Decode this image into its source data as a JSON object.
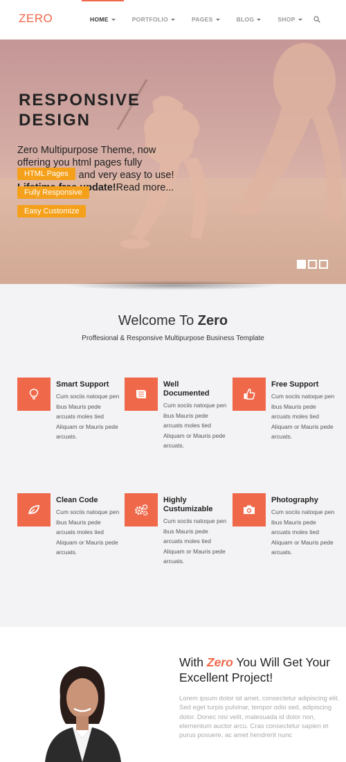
{
  "header": {
    "logo": "ZERO",
    "nav": [
      {
        "label": "HOME",
        "active": true
      },
      {
        "label": "PORTFOLIO",
        "active": false
      },
      {
        "label": "PAGES",
        "active": false
      },
      {
        "label": "BLOG",
        "active": false
      },
      {
        "label": "SHOP",
        "active": false
      }
    ],
    "search_icon": "search-icon"
  },
  "hero": {
    "title_line1": "RESPONSIVE",
    "title_line2": "DESIGN",
    "text": "Zero Multipurpose Theme, now offering you html pages fully customizable and very easy to use!",
    "lifetime": "Lifetime free update!",
    "read_more": "Read more...",
    "buttons": [
      "HTML Pages",
      "Fully Responsive",
      "Easy Customize"
    ],
    "slides_total": 3,
    "slide_active": 1
  },
  "welcome": {
    "title_prefix": "Welcome To ",
    "title_brand": "Zero",
    "subtitle": "Proffesional & Responsive Multipurpose Business Template"
  },
  "features": [
    {
      "title": "Smart Support",
      "icon": "lightbulb-icon",
      "text": "Cum sociis natoque pen ibus Mauris pede arcuats moles tied Aliquam or Mauris pede arcuats."
    },
    {
      "title": "Well Documented",
      "icon": "book-icon",
      "text": "Cum sociis natoque pen ibus Mauris pede arcuats moles tied Aliquam or Mauris pede arcuats."
    },
    {
      "title": "Free Support",
      "icon": "thumbs-up-icon",
      "text": "Cum sociis natoque pen ibus Mauris pede arcuats moles tied Aliquam or Mauris pede arcuats."
    },
    {
      "title": "Clean Code",
      "icon": "leaf-icon",
      "text": "Cum sociis natoque pen ibus Mauris pede arcuats moles tied Aliquam or Mauris pede arcuats."
    },
    {
      "title": "Highly Custumizable",
      "icon": "gears-icon",
      "text": "Cum sociis natoque pen ibus Mauris pede arcuats moles tied Aliquam or Mauris pede arcuats."
    },
    {
      "title": "Photography",
      "icon": "camera-icon",
      "text": "Cum sociis natoque pen ibus Mauris pede arcuats moles tied Aliquam or Mauris pede arcuats."
    }
  ],
  "bottom": {
    "title_pre": "With ",
    "title_brand": "Zero",
    "title_post": " You Will Get Your Excellent Project!",
    "text": "Lorem ipsum dolor sit amet, consectetur adipiscing elit. Sed eget turpis pulvinar, tempor odio sed, adipiscing dolor. Donec nisi velit, malesuada id dolor non, elementum auctor arcu. Cras consectetur sapien et purus posuere, ac amet hendrerit nunc"
  },
  "colors": {
    "accent": "#f0684a",
    "button": "#f5a01a",
    "section_bg": "#f3f3f5"
  }
}
